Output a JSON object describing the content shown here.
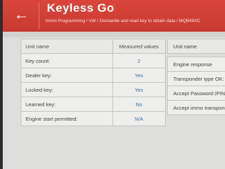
{
  "header": {
    "back_icon": "back-arrow-icon",
    "title": "Keyless Go",
    "breadcrumb": "Immo Programming / VW / Dismantle and read key to obtain data / MQB49XC"
  },
  "left_table": {
    "columns": [
      "Unit name",
      "Measured values"
    ],
    "rows": [
      {
        "name": "Key count:",
        "value": "2"
      },
      {
        "name": "Dealer key:",
        "value": "Yes"
      },
      {
        "name": "Locked key:",
        "value": "Yes"
      },
      {
        "name": "Learned key:",
        "value": "No"
      },
      {
        "name": "Engine start permitted:",
        "value": "N/A"
      }
    ]
  },
  "right_table": {
    "column": "Unit name",
    "rows": [
      "Engine response",
      "Transponder type OK:",
      "Accept Password (PIN)",
      "Accept immo transpond"
    ]
  },
  "colors": {
    "header_red": "#cf3f35",
    "value_blue": "#3a6ea9"
  }
}
